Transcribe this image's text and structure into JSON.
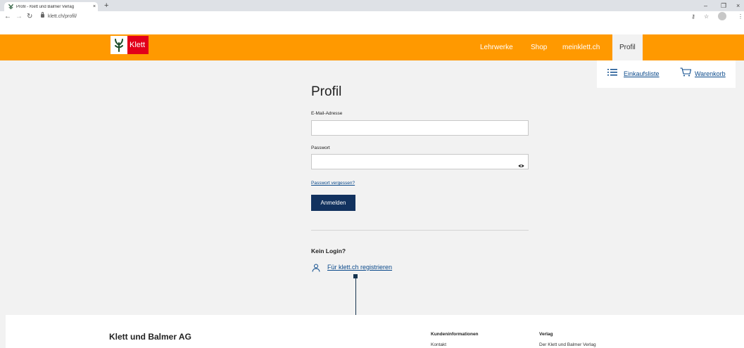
{
  "browser": {
    "tab_title": "Profil - Klett und Balmer Verlag",
    "tab_close": "×",
    "new_tab": "+",
    "url": "klett.ch/profil/",
    "minimize": "–",
    "restore": "❐",
    "close": "×"
  },
  "site": {
    "logo_text": "Klett",
    "nav": [
      "Lehrwerke",
      "Shop",
      "meinklett.ch",
      "Profil"
    ],
    "shopping_list": "Einkaufsliste",
    "cart": "Warenkorb"
  },
  "form": {
    "title": "Profil",
    "email_label": "E-Mail-Adresse",
    "email_value": "",
    "password_label": "Passwort",
    "password_value": "",
    "forgot_password": "Passwort vergessen?",
    "login_button": "Anmelden",
    "no_login": "Kein Login?",
    "register_link": "Für klett.ch registrieren"
  },
  "footer": {
    "company": "Klett und Balmer AG",
    "col1_heading": "Kundeninformationen",
    "col1_item": "Kontakt",
    "col2_heading": "Verlag",
    "col2_item": "Der Klett und Balmer Verlag"
  },
  "colors": {
    "brand_orange": "#ff9900",
    "brand_red": "#e2001a",
    "button_navy": "#12325f",
    "link_blue": "#0b4a8b"
  }
}
